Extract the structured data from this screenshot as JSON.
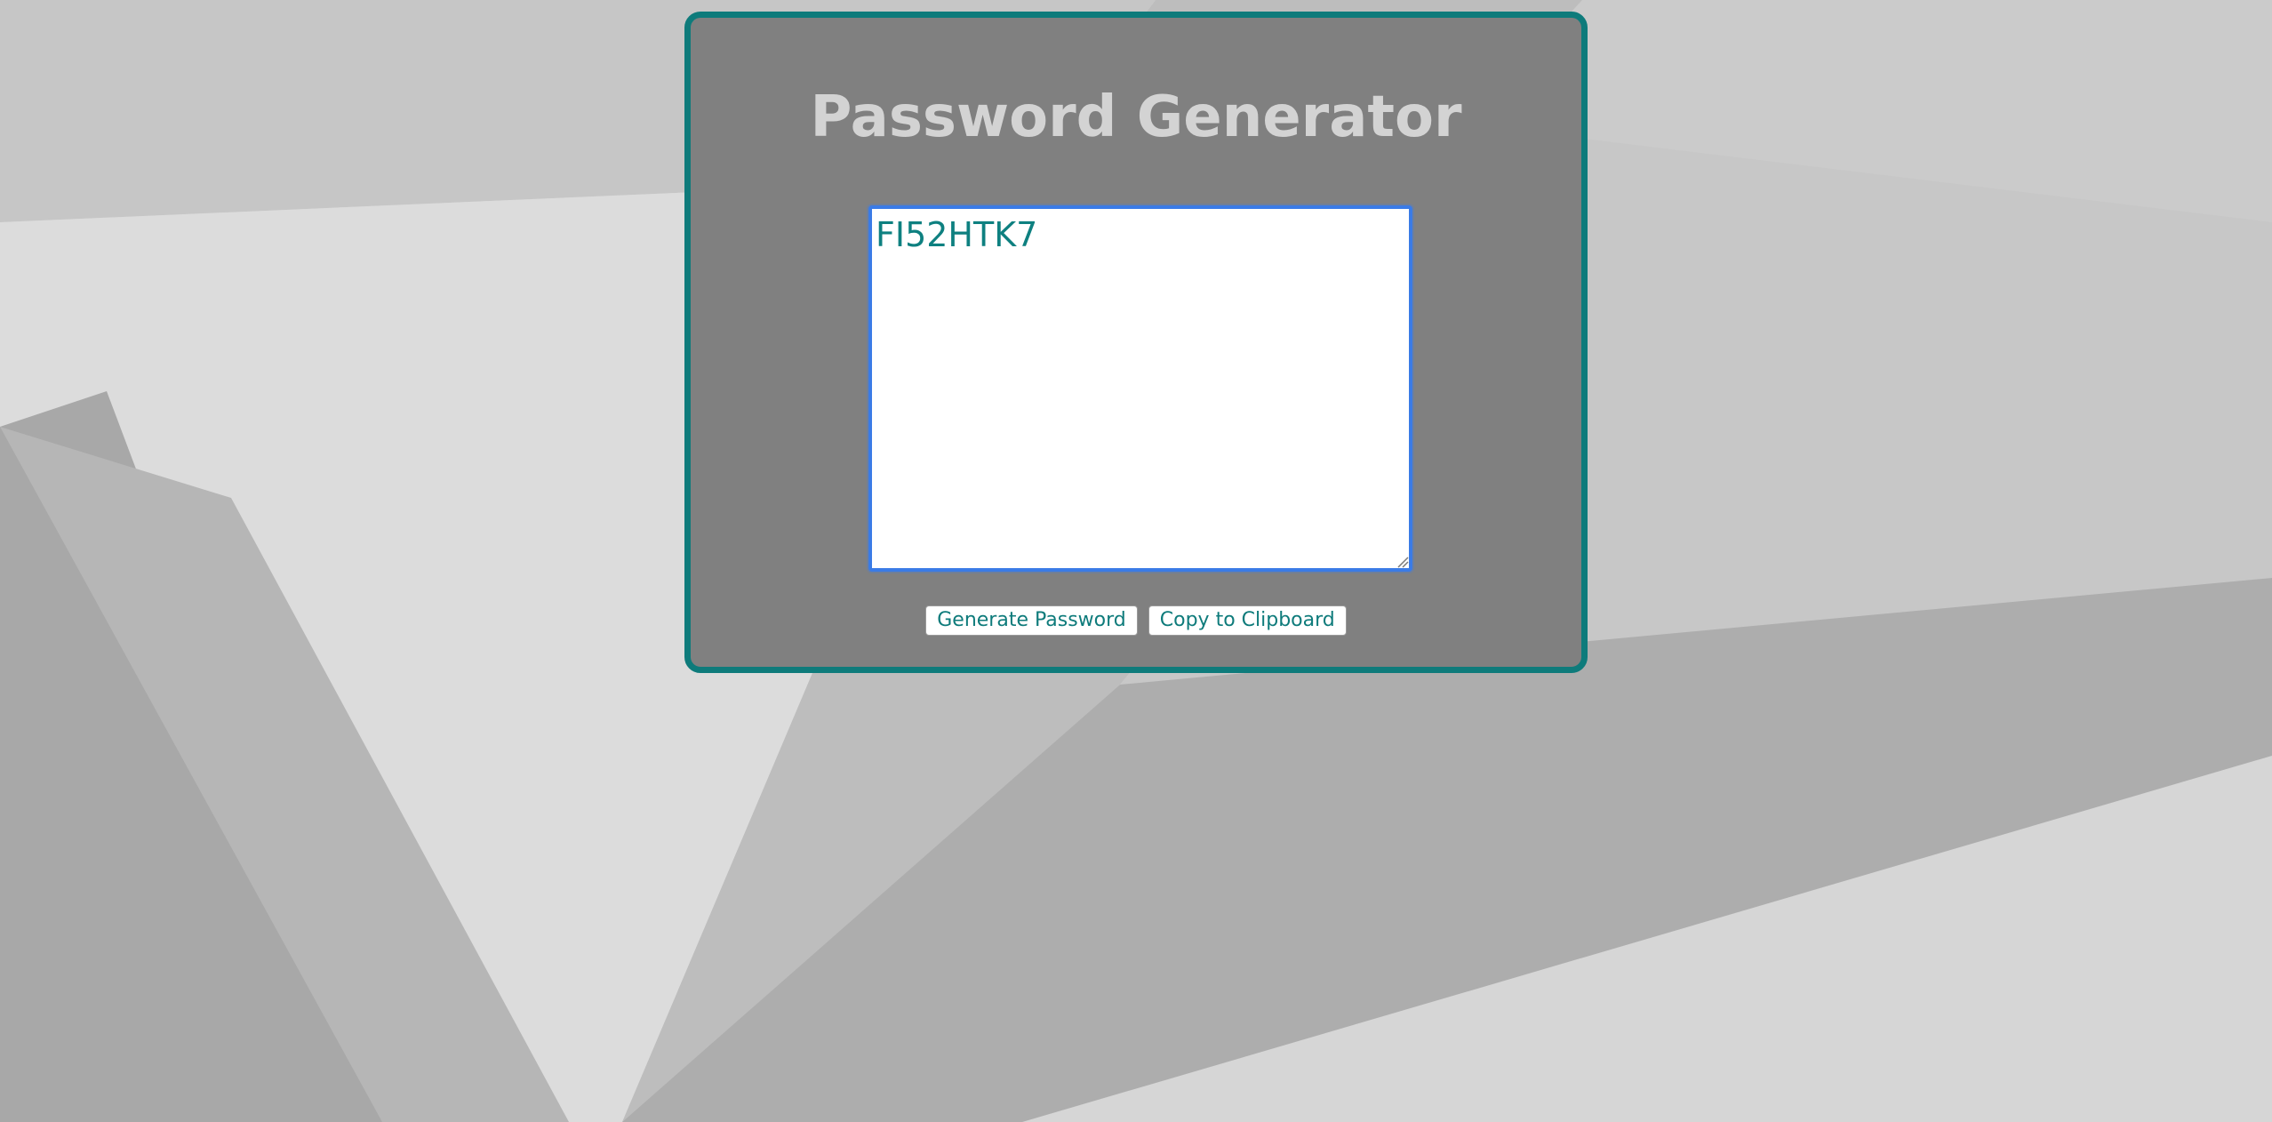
{
  "page": {
    "title": "Password Generator"
  },
  "password_box": {
    "value": "FI52HTK7"
  },
  "buttons": {
    "generate_label": "Generate Password",
    "copy_label": "Copy to Clipboard"
  },
  "colors": {
    "accent": "#0e7b7b",
    "card_background": "#808080",
    "title_text": "#d3d3d3",
    "focus_ring": "#3a7be6"
  },
  "icons": {
    "resize_grip": "resize-grip-icon"
  }
}
